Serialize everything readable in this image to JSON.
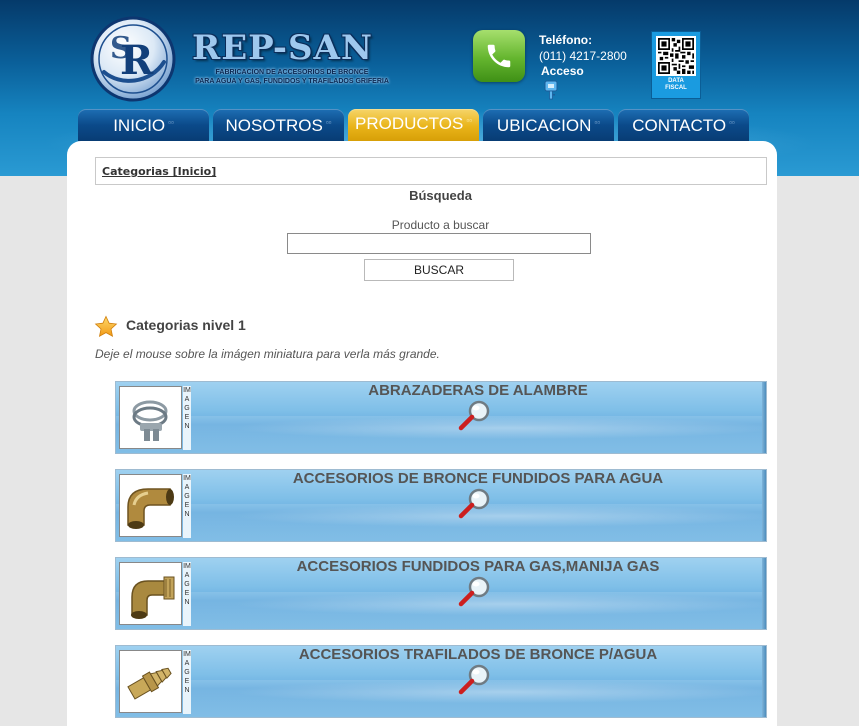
{
  "header": {
    "brand": "REP-SAN",
    "tagline_line1": "FABRICACION DE ACCESORIOS DE BRONCE",
    "tagline_line2": "PARA AGUA Y GAS, FUNDIDOS Y TRAFILADOS GRIFERIA",
    "phone_label": "Teléfono:",
    "phone_number": "(011) 4217-2800",
    "access_label": "Acceso",
    "qr_label_line1": "DATA",
    "qr_label_line2": "FISCAL",
    "logo_letters": "RS"
  },
  "nav": {
    "tabs": [
      {
        "label": "INICIO",
        "active": false
      },
      {
        "label": "NOSOTROS",
        "active": false
      },
      {
        "label": "PRODUCTOS",
        "active": true
      },
      {
        "label": "UBICACION",
        "active": false
      },
      {
        "label": "CONTACTO",
        "active": false
      }
    ]
  },
  "breadcrumb": "Categorias [Inicio]",
  "search": {
    "title": "Búsqueda",
    "label": "Producto a buscar",
    "value": "",
    "button": "BUSCAR"
  },
  "categories": {
    "heading": "Categorias nivel 1",
    "hint": "Deje el mouse sobre la imágen miniatura para verla más grande.",
    "thumb_label": "IMAGEN",
    "items": [
      {
        "title": "ABRAZADERAS DE ALAMBRE",
        "image": "clamp"
      },
      {
        "title": "ACCESORIOS DE BRONCE FUNDIDOS PARA AGUA",
        "image": "elbow"
      },
      {
        "title": "ACCESORIOS FUNDIDOS PARA GAS,MANIJA GAS",
        "image": "elbow-gas"
      },
      {
        "title": "ACCESORIOS TRAFILADOS DE BRONCE P/AGUA",
        "image": "hose-barb"
      }
    ]
  },
  "colors": {
    "header_dark": "#053a6a",
    "header_light": "#2a9ad3",
    "tab_blue": "#0b4a8a",
    "tab_active": "#e9b419",
    "row_blue": "#7fbfe8"
  }
}
